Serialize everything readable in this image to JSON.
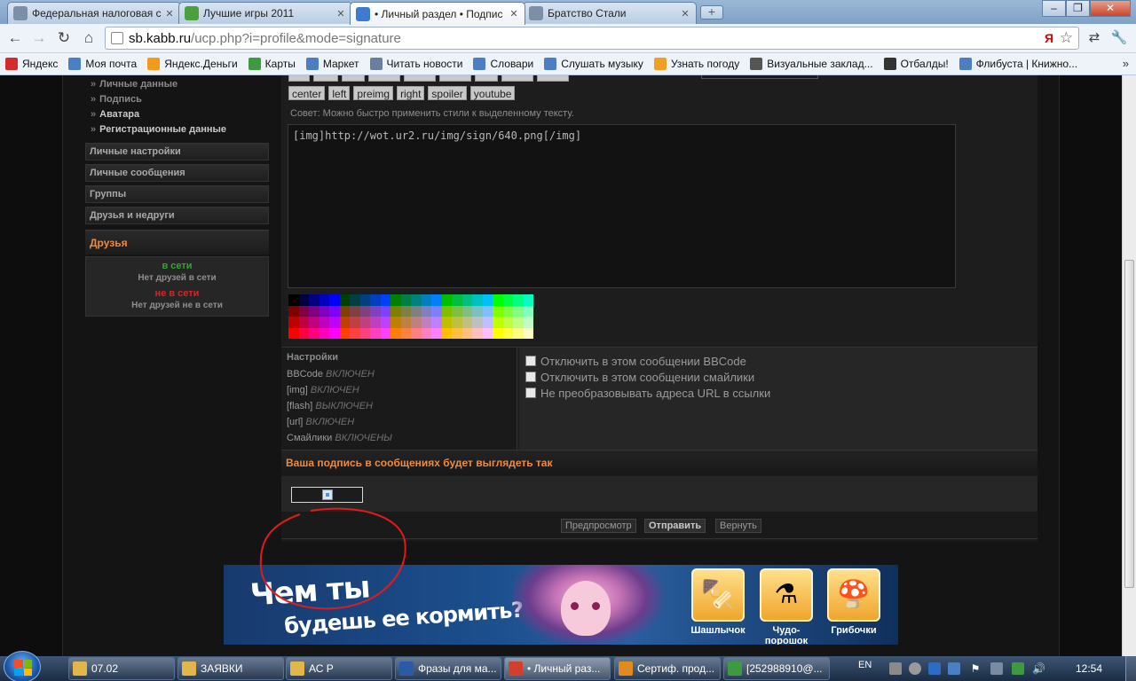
{
  "browser": {
    "tabs": [
      {
        "title": "Федеральная налоговая сл",
        "icon_color": "#7b8fa8",
        "active": false
      },
      {
        "title": "Лучшие игры 2011",
        "icon_color": "#4aa03c",
        "active": false
      },
      {
        "title": "• Личный раздел • Подпис",
        "icon_color": "#3c7bd0",
        "active": true
      },
      {
        "title": "Братство Стали",
        "icon_color": "#7b8fa8",
        "active": false
      }
    ],
    "close_glyph": "✕",
    "newtab_glyph": "+",
    "window_buttons": {
      "minimize": "–",
      "maximize": "❐",
      "close": "✕"
    },
    "url_host": "sb.kabb.ru",
    "url_path": "/ucp.php?i=profile&mode=signature",
    "omnibox_ya": "Я",
    "bookmarks": [
      {
        "label": "Яндекс",
        "icon": "yandex-icon",
        "color": "#d62b2b"
      },
      {
        "label": "Моя почта",
        "icon": "mail-icon",
        "color": "#4a7fc6"
      },
      {
        "label": "Яндекс.Деньги",
        "icon": "money-icon",
        "color": "#f29a1a"
      },
      {
        "label": "Карты",
        "icon": "maps-icon",
        "color": "#3e9a3e"
      },
      {
        "label": "Маркет",
        "icon": "market-icon",
        "color": "#4a7fc6"
      },
      {
        "label": "Читать новости",
        "icon": "news-icon",
        "color": "#6a7fa0"
      },
      {
        "label": "Словари",
        "icon": "dictionary-icon",
        "color": "#4a7fc6"
      },
      {
        "label": "Слушать музыку",
        "icon": "music-icon",
        "color": "#4a7fc6"
      },
      {
        "label": "Узнать погоду",
        "icon": "weather-icon",
        "color": "#f0a020"
      },
      {
        "label": "Визуальные заклад...",
        "icon": "visual-bookmarks-icon",
        "color": "#555555"
      },
      {
        "label": "Отбалды!",
        "icon": "otbaldy-icon",
        "color": "#333333"
      },
      {
        "label": "Флибуста | Книжно...",
        "icon": "flibusta-icon",
        "color": "#4a7fc6"
      }
    ],
    "bookmarks_more": "»"
  },
  "sidebar": {
    "sub_items": [
      {
        "label": "Личные данные",
        "active": false
      },
      {
        "label": "Подпись",
        "active": false
      },
      {
        "label": "Аватара",
        "active": true
      },
      {
        "label": "Регистрационные данные",
        "active": true
      }
    ],
    "bullet": "»",
    "menu": [
      "Личные настройки",
      "Личные сообщения",
      "Группы",
      "Друзья и недруги"
    ],
    "friends_title": "Друзья",
    "online_label": "в сети",
    "online_empty": "Нет друзей в сети",
    "offline_label": "не в сети",
    "offline_empty": "Нет друзей не в сети"
  },
  "editor": {
    "bbcode_buttons_visible": [
      "center",
      "left",
      "preimg",
      "right",
      "spoiler",
      "youtube"
    ],
    "tip": "Совет: Можно быстро применить стили к выделенному тексту.",
    "signature_text": "[img]http://wot.ur2.ru/img/sign/640.png[/img]"
  },
  "options": {
    "title": "Настройки",
    "status": [
      {
        "key": "BBCode",
        "value": "ВКЛЮЧЕН"
      },
      {
        "key": "[img]",
        "value": "ВКЛЮЧЕН"
      },
      {
        "key": "[flash]",
        "value": "ВЫКЛЮЧЕН"
      },
      {
        "key": "[url]",
        "value": "ВКЛЮЧЕН"
      },
      {
        "key": "Смайлики",
        "value": "ВКЛЮЧЕНЫ"
      }
    ],
    "checkboxes": [
      "Отключить в этом сообщении BBCode",
      "Отключить в этом сообщении смайлики",
      "Не преобразовывать адреса URL в ссылки"
    ]
  },
  "preview": {
    "title": "Ваша подпись в сообщениях будет выглядеть так"
  },
  "actions": {
    "preview": "Предпросмотр",
    "submit": "Отправить",
    "reset": "Вернуть"
  },
  "banner": {
    "line1": "Чем ты",
    "line2": "будешь ее кормить?",
    "items": [
      {
        "label": "Шашлычок",
        "icon": "kebab-icon",
        "glyph": "🍢"
      },
      {
        "label": "Чудо-порошок",
        "icon": "potion-icon",
        "glyph": "⚗"
      },
      {
        "label": "Грибочки",
        "icon": "mushroom-icon",
        "glyph": "🍄"
      }
    ]
  },
  "taskbar": {
    "items": [
      {
        "label": "07.02",
        "icon": "folder-icon",
        "color": "#e2b64a",
        "active": false
      },
      {
        "label": "ЗАЯВКИ",
        "icon": "folder-icon",
        "color": "#e2b64a",
        "active": false
      },
      {
        "label": "АС Р",
        "icon": "folder-icon",
        "color": "#e2b64a",
        "active": false
      },
      {
        "label": "Фразы для ма...",
        "icon": "word-icon",
        "color": "#2b5ba8",
        "active": false
      },
      {
        "label": "• Личный раз...",
        "icon": "chrome-icon",
        "color": "#d0402a",
        "active": true
      },
      {
        "label": "Сертиф. прод...",
        "icon": "app-icon",
        "color": "#e08a20",
        "active": false
      },
      {
        "label": "[252988910@...",
        "icon": "qip-icon",
        "color": "#3e9a3e",
        "active": false
      }
    ],
    "lang": "EN",
    "clock": "12:54"
  }
}
